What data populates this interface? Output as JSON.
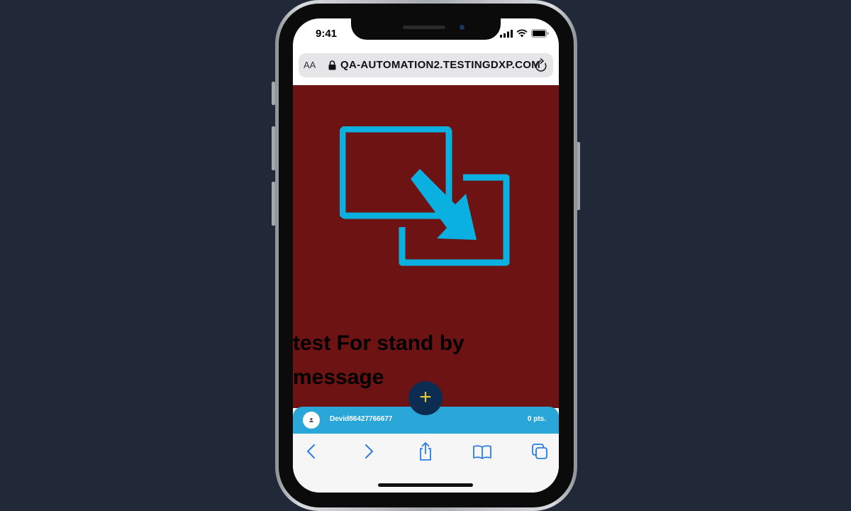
{
  "status_bar": {
    "time": "9:41"
  },
  "address_bar": {
    "text_size_label": "AA",
    "url": "QA-AUTOMATION2.TESTINGDXP.COM"
  },
  "content": {
    "background_color": "#6e1313",
    "icon": "resize-arrow-icon",
    "icon_color": "#0ab0df",
    "message": "test For stand by message"
  },
  "fab": {
    "label": "+"
  },
  "user_bar": {
    "username": "Devid86427766677",
    "points": "0 pts.",
    "background_color": "#2aa6d8"
  },
  "toolbar": {
    "icons": [
      "back-icon",
      "forward-icon",
      "share-icon",
      "bookmarks-icon",
      "tabs-icon"
    ]
  }
}
